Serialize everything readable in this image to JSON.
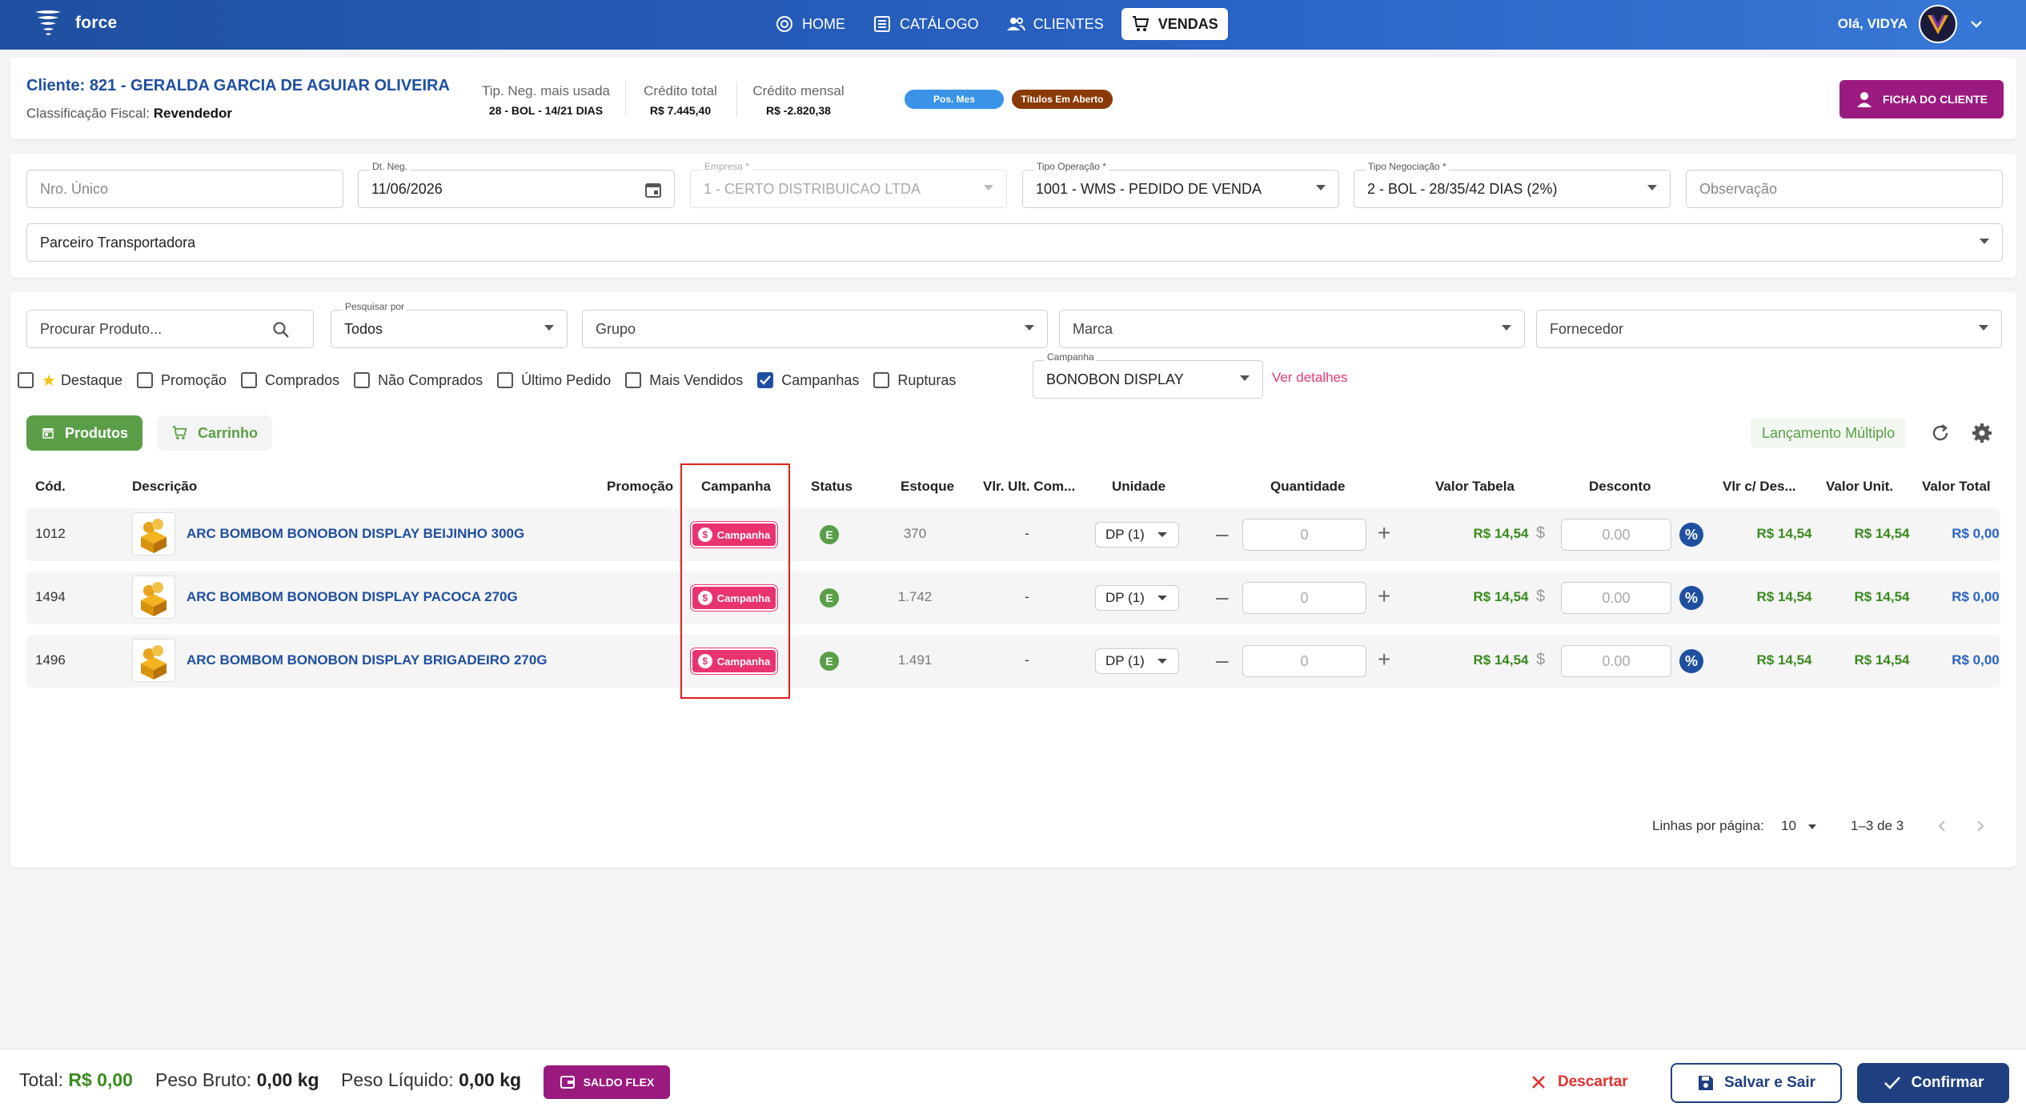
{
  "app": {
    "brand": "force"
  },
  "nav": {
    "items": [
      {
        "label": "HOME",
        "icon": "target-icon"
      },
      {
        "label": "CATÁLOGO",
        "icon": "list-icon"
      },
      {
        "label": "CLIENTES",
        "icon": "users-icon"
      },
      {
        "label": "VENDAS",
        "icon": "cart-icon",
        "active": true
      }
    ]
  },
  "user": {
    "greeting": "Olá, VIDYA"
  },
  "client": {
    "name": "Cliente: 821 - GERALDA GARCIA DE AGUIAR OLIVEIRA",
    "fiscal_label": "Classificação Fiscal:",
    "fiscal_value": "Revendedor",
    "stats": [
      {
        "label": "Tip. Neg. mais usada",
        "value": "28 - BOL - 14/21 DIAS"
      },
      {
        "label": "Crédito total",
        "value": "R$ 7.445,40"
      },
      {
        "label": "Crédito mensal",
        "value": "R$ -2.820,38"
      }
    ],
    "badges": [
      {
        "label": "Pos. Mes",
        "color": "#3b93e8"
      },
      {
        "label": "Títulos Em Aberto",
        "color": "#8a3a06"
      }
    ],
    "ficha_button": "FICHA DO CLIENTE"
  },
  "order": {
    "nro_unico": {
      "placeholder": "Nro. Único"
    },
    "dt_neg": {
      "label": "Dt. Neg.",
      "value": "11/06/2026"
    },
    "empresa": {
      "label": "Empresa *",
      "value": "1 - CERTO DISTRIBUICAO LTDA"
    },
    "tipo_operacao": {
      "label": "Tipo Operação *",
      "value": "1001 - WMS - PEDIDO DE VENDA"
    },
    "tipo_negociacao": {
      "label": "Tipo Negociação *",
      "value": "2 - BOL - 28/35/42 DIAS (2%)"
    },
    "observacao": {
      "placeholder": "Observação"
    },
    "parceiro": {
      "placeholder": "Parceiro Transportadora"
    }
  },
  "filters": {
    "search": {
      "placeholder": "Procurar Produto..."
    },
    "pesquisar_por": {
      "label": "Pesquisar por",
      "value": "Todos"
    },
    "grupo": {
      "placeholder": "Grupo"
    },
    "marca": {
      "placeholder": "Marca"
    },
    "fornecedor": {
      "placeholder": "Fornecedor"
    },
    "checkboxes": [
      {
        "label": "Destaque",
        "checked": false,
        "star": true
      },
      {
        "label": "Promoção",
        "checked": false
      },
      {
        "label": "Comprados",
        "checked": false
      },
      {
        "label": "Não Comprados",
        "checked": false
      },
      {
        "label": "Último Pedido",
        "checked": false
      },
      {
        "label": "Mais Vendidos",
        "checked": false
      },
      {
        "label": "Campanhas",
        "checked": true
      },
      {
        "label": "Rupturas",
        "checked": false
      }
    ],
    "campanha": {
      "label": "Campanha",
      "value": "BONOBON DISPLAY"
    },
    "ver_detalhes": "Ver detalhes"
  },
  "tabs": {
    "produtos": "Produtos",
    "carrinho": "Carrinho",
    "lancamento": "Lançamento Múltiplo"
  },
  "table": {
    "headers": {
      "cod": "Cód.",
      "descricao": "Descrição",
      "promocao": "Promoção",
      "campanha": "Campanha",
      "status": "Status",
      "estoque": "Estoque",
      "vlr_ult": "Vlr. Ult. Com...",
      "unidade": "Unidade",
      "quantidade": "Quantidade",
      "valor_tabela": "Valor Tabela",
      "desconto": "Desconto",
      "vlr_c_desc": "Vlr c/ Des...",
      "valor_unit": "Valor Unit.",
      "valor_total": "Valor Total"
    },
    "rows": [
      {
        "cod": "1012",
        "descricao": "ARC BOMBOM BONOBON DISPLAY BEIJINHO 300G",
        "campanha": "Campanha",
        "status": "E",
        "estoque": "370",
        "vlr_ult": "-",
        "unidade": "DP (1)",
        "quantidade": "0",
        "valor_tabela": "R$ 14,54",
        "desconto": "0.00",
        "vlr_c_desc": "R$ 14,54",
        "valor_unit": "R$ 14,54",
        "valor_total": "R$ 0,00"
      },
      {
        "cod": "1494",
        "descricao": "ARC BOMBOM BONOBON DISPLAY PACOCA 270G",
        "campanha": "Campanha",
        "status": "E",
        "estoque": "1.742",
        "vlr_ult": "-",
        "unidade": "DP (1)",
        "quantidade": "0",
        "valor_tabela": "R$ 14,54",
        "desconto": "0.00",
        "vlr_c_desc": "R$ 14,54",
        "valor_unit": "R$ 14,54",
        "valor_total": "R$ 0,00"
      },
      {
        "cod": "1496",
        "descricao": "ARC BOMBOM BONOBON DISPLAY BRIGADEIRO 270G",
        "campanha": "Campanha",
        "status": "E",
        "estoque": "1.491",
        "vlr_ult": "-",
        "unidade": "DP (1)",
        "quantidade": "0",
        "valor_tabela": "R$ 14,54",
        "desconto": "0.00",
        "vlr_c_desc": "R$ 14,54",
        "valor_unit": "R$ 14,54",
        "valor_total": "R$ 0,00"
      }
    ]
  },
  "pagination": {
    "rows_label": "Linhas por página:",
    "rows_value": "10",
    "range": "1–3 de 3"
  },
  "footer": {
    "total_label": "Total:",
    "total_value": "R$ 0,00",
    "peso_bruto_label": "Peso Bruto:",
    "peso_bruto_value": "0,00 kg",
    "peso_liquido_label": "Peso Líquido:",
    "peso_liquido_value": "0,00 kg",
    "saldo_flex": "SALDO FLEX",
    "descartar": "Descartar",
    "salvar": "Salvar e Sair",
    "confirmar": "Confirmar"
  }
}
